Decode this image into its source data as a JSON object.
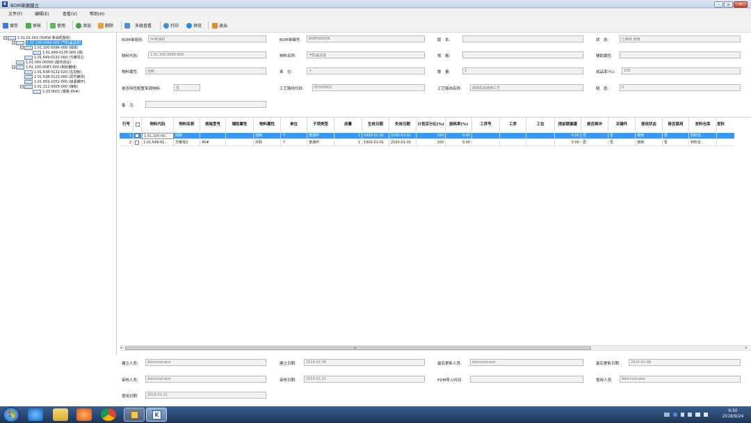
{
  "window": {
    "title": "BOM单据建立",
    "icon_label": "K"
  },
  "menu": [
    "文件(F)",
    "编辑(E)",
    "查看(V)",
    "帮助(H)"
  ],
  "toolbar": {
    "save": "保存",
    "audit": "审核",
    "use": "使用",
    "add": "添加",
    "delete": "删除",
    "multi_view": "多级查看",
    "print": "打印",
    "preview": "预览",
    "exit": "退出"
  },
  "tree": [
    {
      "label": "1.01.01.001 (50KW 柴油机整机)"
    },
    {
      "label": "1.01.100-0066-000 (气缸盖总成)"
    },
    {
      "label": "1.01.100-0096-000 (阀体)"
    },
    {
      "label": "1.01.649-0135-000 (阀)"
    },
    {
      "label": "1.01.649-0132-000 (方螺母2)"
    },
    {
      "label": "1.01.000.00000 (服务协议)"
    },
    {
      "label": "1.01.100-0087-000 (制动器组)"
    },
    {
      "label": "1.01.638-0132-020 (右割板)"
    },
    {
      "label": "1.01.638-0123-000 (调节螺母)"
    },
    {
      "label": "1.01.659-1052-000 (锁紧螺杆)"
    },
    {
      "label": "1.01.312-0005-000 (接板)"
    },
    {
      "label": "1.03.0001 (钢板 45#)"
    }
  ],
  "form": {
    "bom_group": {
      "label": "BOM单组别:",
      "value": "50柴油机"
    },
    "bom_no": {
      "label": "BOM单编号:",
      "value": "BOM000006"
    },
    "version": {
      "label": "版　本:",
      "value": ""
    },
    "status": {
      "label": "状　态:",
      "value": "已审核  使用"
    },
    "item_code": {
      "label": "物料代码:",
      "value": "1.01.100-0066-000"
    },
    "item_name": {
      "label": "物料名称:",
      "value": "气缸盖总成"
    },
    "spec": {
      "label": "规　格:",
      "value": ""
    },
    "aux_attr": {
      "label": "辅助属性:",
      "value": ""
    },
    "item_attr": {
      "label": "物料属性:",
      "value": "自制"
    },
    "unit": {
      "label": "单　位:",
      "value": "个"
    },
    "qty": {
      "label": "数　量:",
      "value": "1"
    },
    "yield": {
      "label": "成品率(%):",
      "value": "100"
    },
    "config_source": {
      "label": "是否特性配置来源物料:",
      "value": "否"
    },
    "route_code": {
      "label": "工艺路线代码:",
      "value": "RT000002"
    },
    "route_name": {
      "label": "工艺路线名称:",
      "value": "阀体机加通用工艺"
    },
    "level": {
      "label": "跳　层:",
      "value": "0"
    },
    "remark": {
      "label": "备　注:",
      "value": ""
    }
  },
  "grid": {
    "headers": [
      "行号",
      "",
      "物料代码",
      "物料名称",
      "规格型号",
      "辅助属性",
      "物料属性",
      "单位",
      "子项类型",
      "用量",
      "生效日期",
      "失效日期",
      "计划百分比(%)",
      "损耗率(%)",
      "工序号",
      "工序",
      "工位",
      "提前期偏置",
      "是否倒冲",
      "关键件",
      "使用状态",
      "是否禁用",
      "发料仓库",
      "发料"
    ],
    "rows": [
      [
        "1",
        "",
        "1.01.100-00...",
        "阀体",
        "",
        "",
        "自制",
        "个",
        "普通件",
        "1",
        "1900-01-01",
        "2100-01-01",
        "100",
        "0.00",
        "",
        "",
        "",
        "0.00",
        "否",
        "否",
        "使用",
        "否",
        "材料仓...",
        ""
      ],
      [
        "2",
        "",
        "1.01.649-01...",
        "方螺母2",
        "45#",
        "",
        "外购",
        "个",
        "普通件",
        "1",
        "1900-01-01",
        "2100-01-01",
        "100",
        "0.00",
        "",
        "",
        "",
        "0.00",
        "否",
        "否",
        "使用",
        "否",
        "材料仓...",
        ""
      ]
    ],
    "scroll_center": "III"
  },
  "footer": {
    "creator": {
      "label": "建立人员:",
      "value": "Administrator"
    },
    "create_date": {
      "label": "建立日期:",
      "value": "2014-01-08"
    },
    "updater": {
      "label": "最后更新人员:",
      "value": "Administrator"
    },
    "update_date": {
      "label": "最后更新日期:",
      "value": "2014-01-08"
    },
    "auditor": {
      "label": "审核人员:",
      "value": "Administrator"
    },
    "audit_date": {
      "label": "审核日期:",
      "value": "2014-01-21"
    },
    "pdm_time": {
      "label": "PDM导入时间:",
      "value": ""
    },
    "user": {
      "label": "使用人员:",
      "value": "Administrator"
    },
    "use_date": {
      "label": "使用日期:",
      "value": "2014-01-21"
    }
  },
  "taskbar": {
    "time": "9:50",
    "date": "2018/9/24",
    "active_label": "K"
  },
  "colors": {
    "selection": "#3399ff",
    "taskbar": "#1d3557"
  }
}
